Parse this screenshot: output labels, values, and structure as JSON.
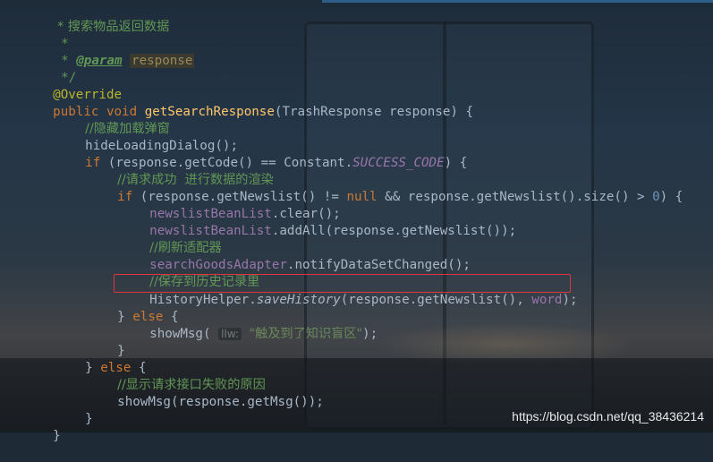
{
  "code": {
    "doc_comment_title": "* 搜索物品返回数据",
    "doc_star": "*",
    "param_tag": "@param",
    "param_name": "response",
    "doc_end": "*/",
    "annotation": "@Override",
    "kw_public": "public",
    "kw_void": "void",
    "method_name": "getSearchResponse",
    "method_params": "(TrashResponse response) {",
    "comment_hide": "//隐藏加载弹窗",
    "call_hide": "hideLoadingDialog();",
    "kw_if": "if",
    "if_cond_start": " (response.getCode() == Constant.",
    "const_success": "SUCCESS_CODE",
    "if_cond_end": ") {",
    "comment_success": "//请求成功  进行数据的渲染",
    "if2_start": " (response.getNewslist() != ",
    "kw_null": "null",
    "if2_mid": " && response.getNewslist().size() > ",
    "num_zero": "0",
    "if2_end": ") {",
    "field_list": "newslistBeanList",
    "call_clear": ".clear();",
    "call_addall": ".addAll(response.getNewslist());",
    "comment_refresh": "//刷新适配器",
    "field_adapter": "searchGoodsAdapter",
    "call_notify": ".notifyDataSetChanged();",
    "comment_save": "//保存到历史记录里",
    "history_class": "HistoryHelper.",
    "history_method": "saveHistory",
    "history_args": "(response.getNewslist(), ",
    "history_word": "word",
    "history_end": ");",
    "close_brace": "}",
    "kw_else": "else",
    "open_brace": " {",
    "call_showmsg": "showMsg(",
    "hint_label": "llw:",
    "str_msg": "\"触及到了知识盲区\"",
    "call_end": ");",
    "comment_fail": "//显示请求接口失败的原因",
    "call_showmsg2": "showMsg(response.getMsg());"
  },
  "watermark": "https://blog.csdn.net/qq_38436214",
  "colors": {
    "comment": "#629755",
    "keyword": "#cc7832",
    "method_decl": "#ffc66d",
    "field": "#9876aa",
    "annotation": "#bbb529",
    "number": "#6897bb",
    "string": "#6a8759",
    "highlight_box": "#e0343a"
  }
}
